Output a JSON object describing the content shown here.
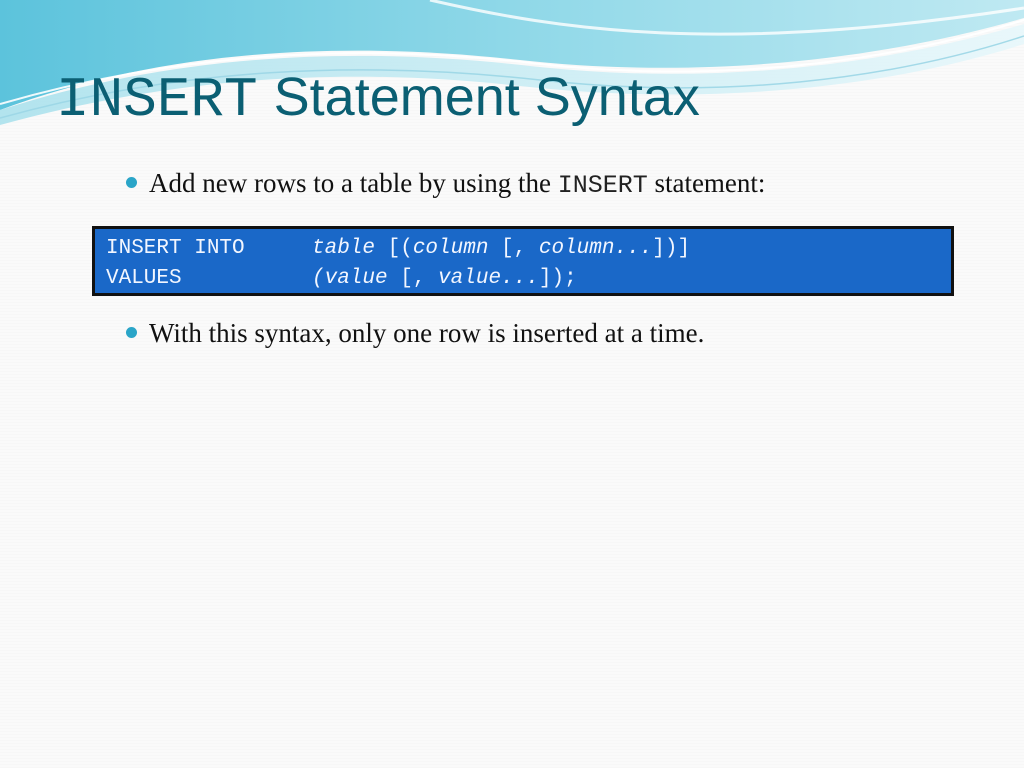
{
  "slide": {
    "title_code": "INSERT",
    "title_text": "Statement Syntax",
    "bullets": [
      {
        "before": "Add new rows to a table by using the ",
        "code": "INSERT",
        "after": " statement:"
      },
      {
        "text": "With this syntax, only one row is inserted at a time."
      }
    ],
    "code_block": {
      "line1": {
        "keyword": "INSERT INTO",
        "p1": "table",
        "p2": " [(",
        "p3": "column",
        "p4": " [, ",
        "p5": "column...",
        "p6": "])]"
      },
      "line2": {
        "keyword": "VALUES",
        "p1": "(value",
        "p2": " [, ",
        "p3": "value...",
        "p4": "]);"
      }
    }
  },
  "colors": {
    "title": "#0b5f73",
    "bullet_dot": "#2aa5c8",
    "code_background": "#1a68c8",
    "code_text": "#f2f6ff"
  }
}
